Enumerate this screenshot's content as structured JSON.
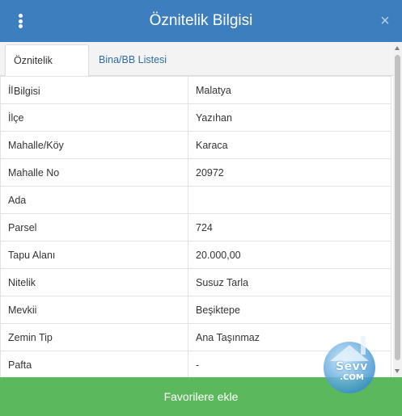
{
  "header": {
    "title": "Öznitelik Bilgisi",
    "close_symbol": "×",
    "menu_icon": "vertical-dots-icon",
    "color": "#3d7ebf"
  },
  "tabs": [
    {
      "label": "Öznitelik Bilgisi",
      "active": true
    },
    {
      "label": "Bina/BB Listesi",
      "active": false
    }
  ],
  "attributes": [
    {
      "key": "İl",
      "value": "Malatya"
    },
    {
      "key": "İlçe",
      "value": "Yazıhan"
    },
    {
      "key": "Mahalle/Köy",
      "value": "Karaca"
    },
    {
      "key": "Mahalle No",
      "value": "20972"
    },
    {
      "key": "Ada",
      "value": ""
    },
    {
      "key": "Parsel",
      "value": "724"
    },
    {
      "key": "Tapu Alanı",
      "value": "20.000,00"
    },
    {
      "key": "Nitelik",
      "value": "Susuz Tarla"
    },
    {
      "key": "Mevkii",
      "value": "Beşiktepe"
    },
    {
      "key": "Zemin Tip",
      "value": "Ana Taşınmaz"
    },
    {
      "key": "Pafta",
      "value": "-"
    }
  ],
  "footer": {
    "button_label": "Favorilere ekle",
    "color": "#5cb85c"
  },
  "watermark": {
    "brand": "Sevv",
    "domain": ".COM"
  }
}
